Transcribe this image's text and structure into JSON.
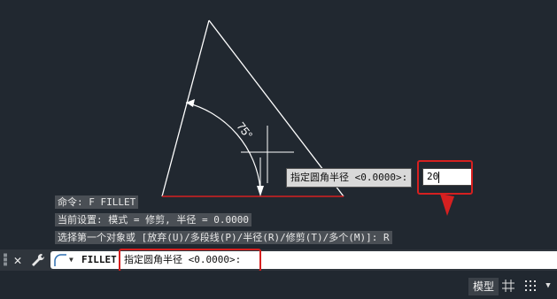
{
  "colors": {
    "canvas_bg": "#212830",
    "drawing_line": "#ffffff",
    "selected_line": "#d62020",
    "highlight_box": "#d62020",
    "command_bar": "#2f353c",
    "history_bg": "#4a4f55",
    "tooltip_bg": "#d9d9d9"
  },
  "drawing": {
    "angle_label": "75°"
  },
  "dynamic_input": {
    "prompt": "指定圆角半径 <0.0000>:",
    "value": "20"
  },
  "history": [
    "命令: F FILLET",
    "当前设置: 模式 = 修剪, 半径 = 0.0000",
    "选择第一个对象或 [放弃(U)/多段线(P)/半径(R)/修剪(T)/多个(M)]: R"
  ],
  "command_line": {
    "close_icon": "close-icon",
    "customize_icon": "wrench-icon",
    "command_icon": "fillet-arc-icon",
    "command_name": "FILLET",
    "prompt": "指定圆角半径 <0.0000>:"
  },
  "status_bar": {
    "model_tab": "模型",
    "icons": [
      "grid-icon",
      "snap-icon",
      "chevron-down-icon"
    ]
  }
}
